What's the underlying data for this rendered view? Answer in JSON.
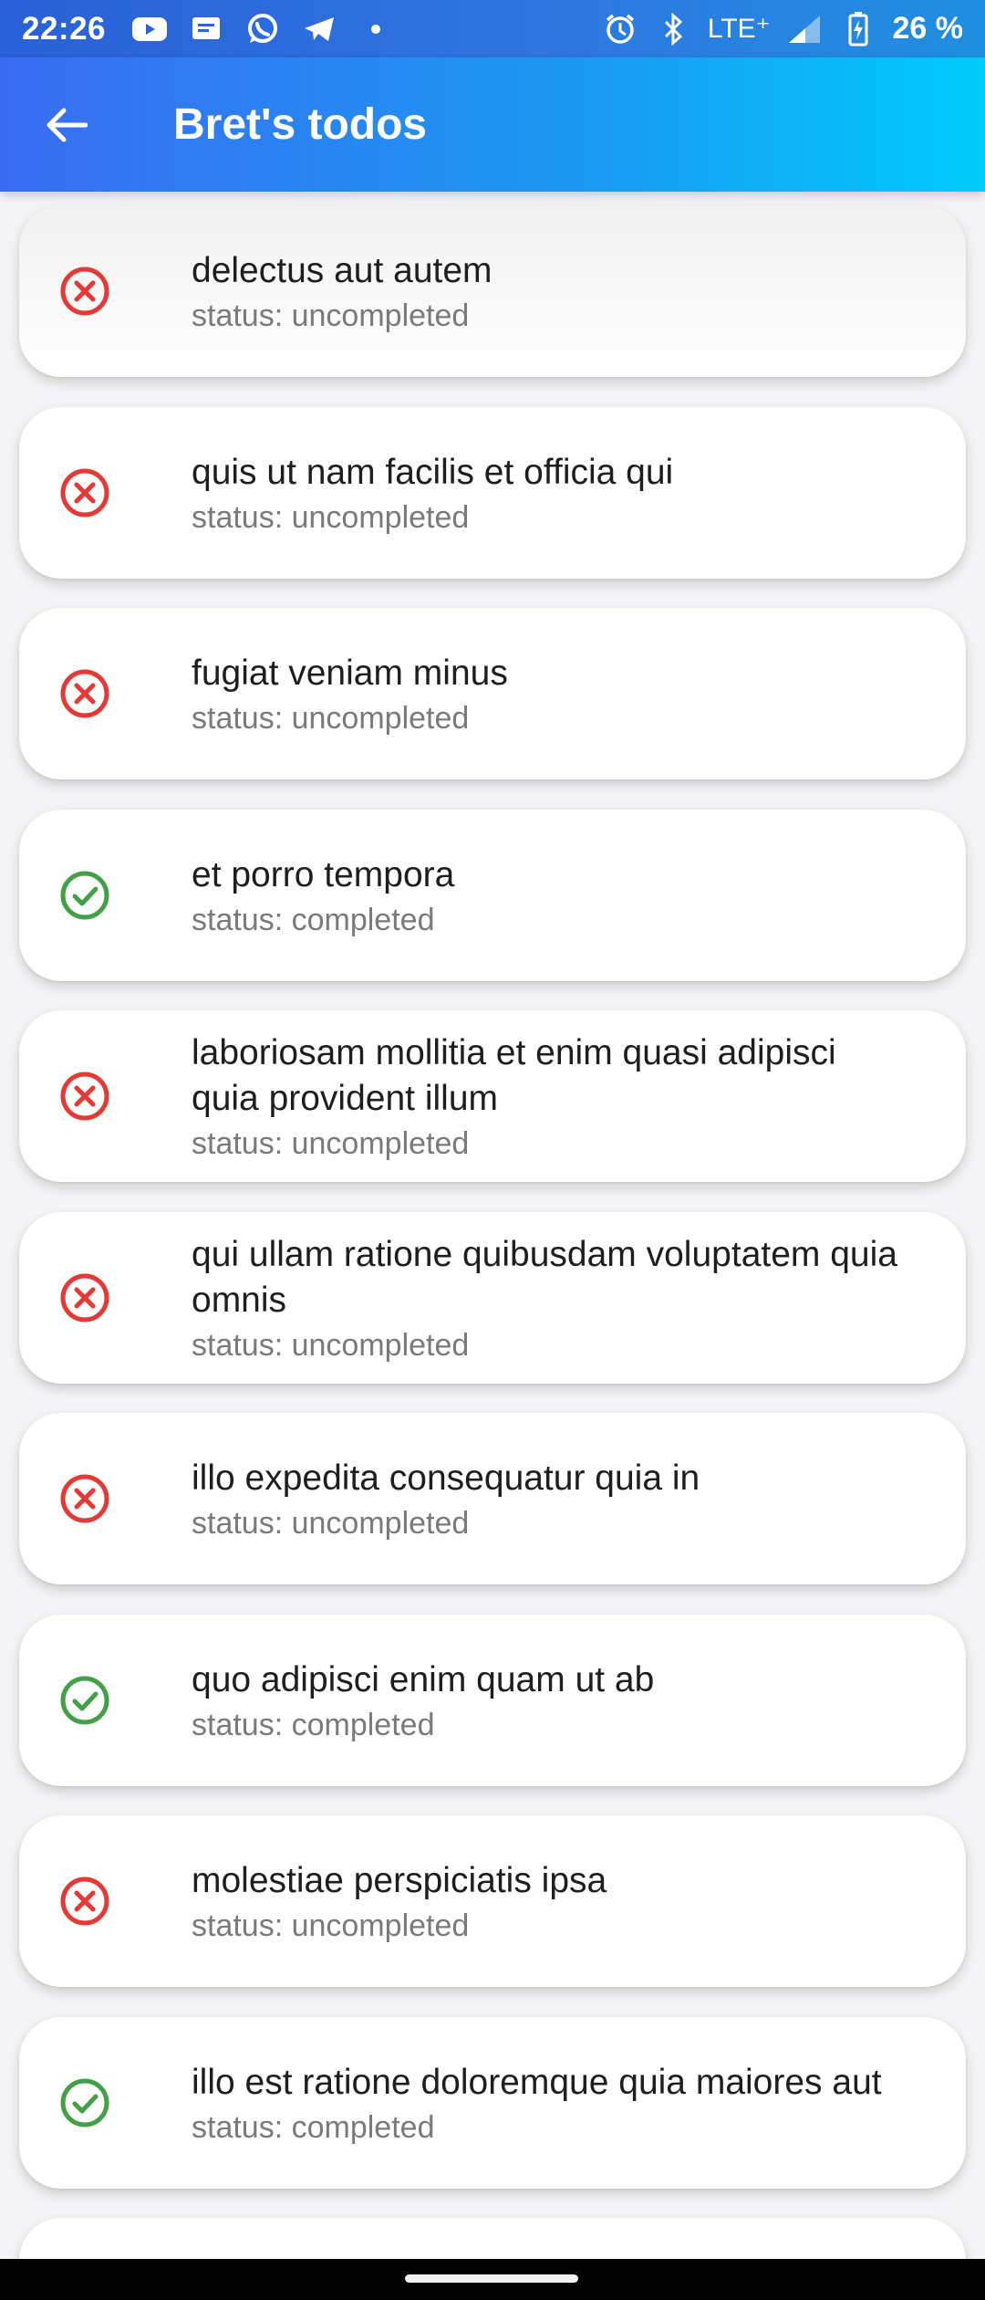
{
  "status_bar": {
    "time": "22:26",
    "network": "LTE⁺",
    "battery_percent": "26 %",
    "icons": [
      "youtube-icon",
      "message-icon",
      "whatsapp-icon",
      "telegram-icon",
      "notification-dot-icon",
      "alarm-icon",
      "bluetooth-icon",
      "signal-icon",
      "battery-charging-icon"
    ]
  },
  "app_bar": {
    "back_icon": "arrow-back-icon",
    "title": "Bret's todos",
    "gradient_colors": [
      "#3a6cf2",
      "#00ccfb"
    ]
  },
  "colors": {
    "uncompleted": "#e53935",
    "completed": "#43a047"
  },
  "todos": [
    {
      "title": "delectus aut autem",
      "status": "status: uncompleted",
      "completed": false
    },
    {
      "title": "quis ut nam facilis et officia qui",
      "status": "status: uncompleted",
      "completed": false
    },
    {
      "title": "fugiat veniam minus",
      "status": "status: uncompleted",
      "completed": false
    },
    {
      "title": "et porro tempora",
      "status": "status: completed",
      "completed": true
    },
    {
      "title": "laboriosam mollitia et enim quasi adipisci quia provident illum",
      "status": "status: uncompleted",
      "completed": false
    },
    {
      "title": "qui ullam ratione quibusdam voluptatem quia omnis",
      "status": "status: uncompleted",
      "completed": false
    },
    {
      "title": "illo expedita consequatur quia in",
      "status": "status: uncompleted",
      "completed": false
    },
    {
      "title": "quo adipisci enim quam ut ab",
      "status": "status: completed",
      "completed": true
    },
    {
      "title": "molestiae perspiciatis ipsa",
      "status": "status: uncompleted",
      "completed": false
    },
    {
      "title": "illo est ratione doloremque quia maiores aut",
      "status": "status: completed",
      "completed": true
    }
  ]
}
